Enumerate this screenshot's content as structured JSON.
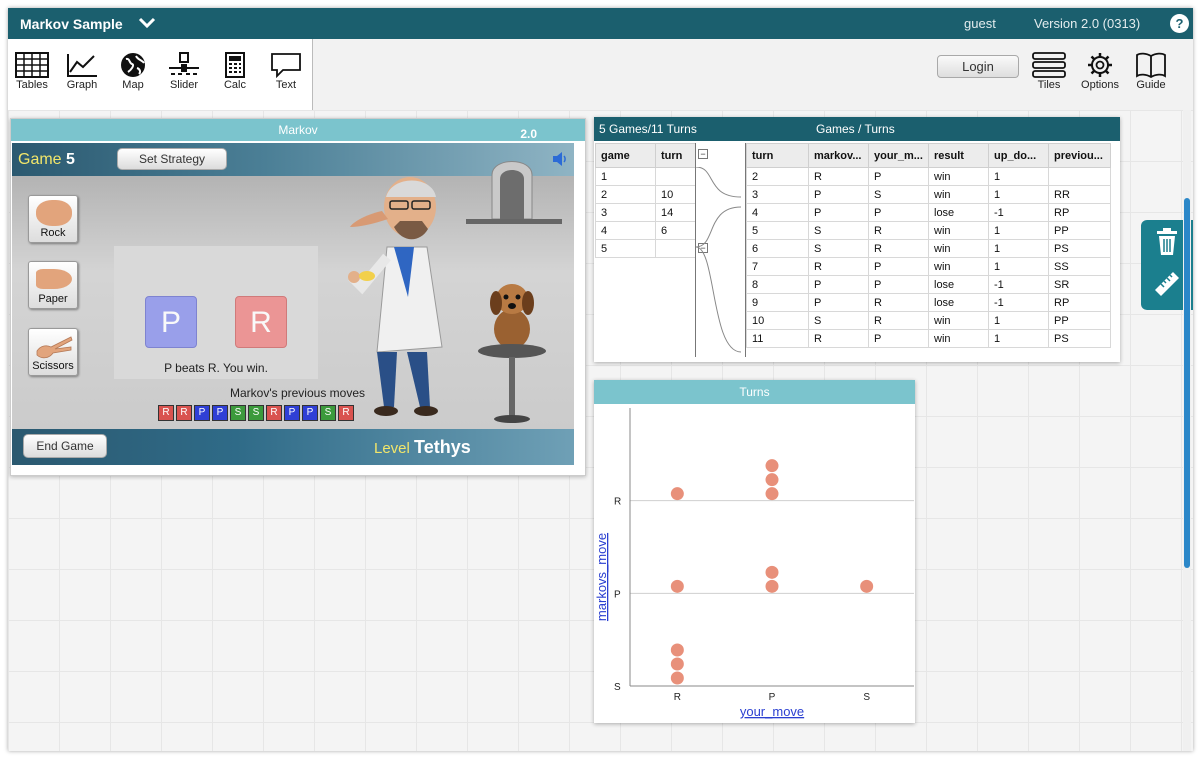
{
  "app": {
    "title": "Markov Sample",
    "user": "guest",
    "version": "Version 2.0 (0313)",
    "help": "?"
  },
  "toolshelf": {
    "tools": [
      "Tables",
      "Graph",
      "Map",
      "Slider",
      "Calc",
      "Text"
    ],
    "login": "Login",
    "right_tools": [
      "Tiles",
      "Options",
      "Guide"
    ]
  },
  "markov": {
    "title": "Markov",
    "version": "2.0",
    "game_label": "Game",
    "game_number": "5",
    "set_strategy": "Set Strategy",
    "buttons": [
      "Rock",
      "Paper",
      "Scissors"
    ],
    "your_card": "P",
    "markov_card": "R",
    "result_text": "P beats R. You win.",
    "prev_moves_label": "Markov's previous moves",
    "prev_moves": [
      "R",
      "R",
      "P",
      "P",
      "S",
      "S",
      "R",
      "P",
      "P",
      "S",
      "R"
    ],
    "end_game": "End Game",
    "level_label": "Level",
    "level_name": "Tethys",
    "colors": {
      "R": "#d9534f",
      "P": "#2f3fd6",
      "S": "#3c9a3c"
    }
  },
  "table": {
    "count": "5 Games/11 Turns",
    "title": "Games / Turns",
    "parent_headers": [
      "game",
      "turn"
    ],
    "parent_rows": [
      [
        "1",
        ""
      ],
      [
        "2",
        "10"
      ],
      [
        "3",
        "14"
      ],
      [
        "4",
        "6"
      ],
      [
        "5",
        ""
      ]
    ],
    "child_headers": [
      "turn",
      "markov...",
      "your_m...",
      "result",
      "up_do...",
      "previou..."
    ],
    "child_rows": [
      [
        "2",
        "R",
        "P",
        "win",
        "1",
        ""
      ],
      [
        "3",
        "P",
        "S",
        "win",
        "1",
        "RR"
      ],
      [
        "4",
        "P",
        "P",
        "lose",
        "-1",
        "RP"
      ],
      [
        "5",
        "S",
        "R",
        "win",
        "1",
        "PP"
      ],
      [
        "6",
        "S",
        "R",
        "win",
        "1",
        "PS"
      ],
      [
        "7",
        "R",
        "P",
        "win",
        "1",
        "SS"
      ],
      [
        "8",
        "P",
        "P",
        "lose",
        "-1",
        "SR"
      ],
      [
        "9",
        "P",
        "R",
        "lose",
        "-1",
        "RP"
      ],
      [
        "10",
        "S",
        "R",
        "win",
        "1",
        "PP"
      ],
      [
        "11",
        "R",
        "P",
        "win",
        "1",
        "PS"
      ]
    ]
  },
  "graph": {
    "title": "Turns",
    "x_label": "your_move",
    "y_label": "markovs_move",
    "x_categories": [
      "R",
      "P",
      "S"
    ],
    "y_categories": [
      "S",
      "P",
      "R"
    ],
    "point_color": "#e8907a",
    "points": [
      {
        "x": "R",
        "y": "R",
        "count": 1
      },
      {
        "x": "P",
        "y": "R",
        "count": 3
      },
      {
        "x": "R",
        "y": "P",
        "count": 1
      },
      {
        "x": "P",
        "y": "P",
        "count": 2
      },
      {
        "x": "S",
        "y": "P",
        "count": 1
      },
      {
        "x": "R",
        "y": "S",
        "count": 3
      }
    ]
  }
}
